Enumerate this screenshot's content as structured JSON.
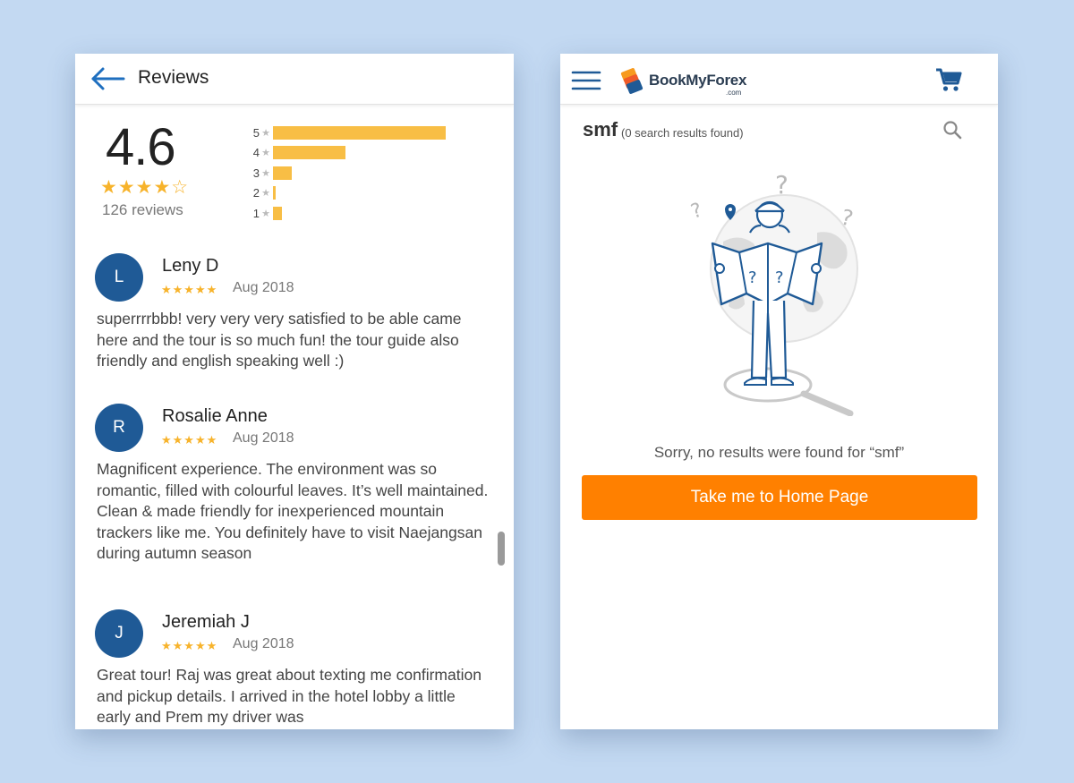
{
  "reviews_screen": {
    "title": "Reviews",
    "summary": {
      "rating": "4.6",
      "stars": "★★★★☆",
      "count_text": "126 reviews",
      "distribution": [
        {
          "label": "5",
          "fraction": 1.0
        },
        {
          "label": "4",
          "fraction": 0.42
        },
        {
          "label": "3",
          "fraction": 0.11
        },
        {
          "label": "2",
          "fraction": 0.015
        },
        {
          "label": "1",
          "fraction": 0.05
        }
      ]
    },
    "reviews": [
      {
        "initial": "L",
        "name": "Leny D",
        "stars": "★★★★★",
        "date": "Aug 2018",
        "text": "superrrrbbb! very very very satisfied to be able came here and the tour is so much fun! the tour guide also friendly and english speaking well :)"
      },
      {
        "initial": "R",
        "name": "Rosalie Anne",
        "stars": "★★★★★",
        "date": "Aug 2018",
        "text": "Magnificent experience. The environment was so romantic, filled with colourful leaves. It’s well maintained. Clean & made friendly for inexperienced mountain trackers like me. You definitely have to visit Naejangsan during autumn season"
      },
      {
        "initial": "J",
        "name": "Jeremiah J",
        "stars": "★★★★★",
        "date": "Aug 2018",
        "text": "Great tour! Raj was great about texting me confirmation and pickup details. I arrived in the hotel lobby a little early and Prem my driver was"
      }
    ]
  },
  "search_screen": {
    "logo": {
      "name": "BookMyForex",
      "suffix": ".com"
    },
    "query": "smf",
    "result_count_text": "(0 search results found)",
    "empty_message": "Sorry, no results were found for “smf”",
    "cta_label": "Take me to Home Page",
    "icons": [
      "hamburger-icon",
      "cart-icon",
      "search-icon",
      "lost-traveler-illustration"
    ]
  },
  "colors": {
    "background": "#c3d9f2",
    "primary_blue": "#1f5a96",
    "star_yellow": "#f7b32b",
    "cta_orange": "#ff8000"
  }
}
